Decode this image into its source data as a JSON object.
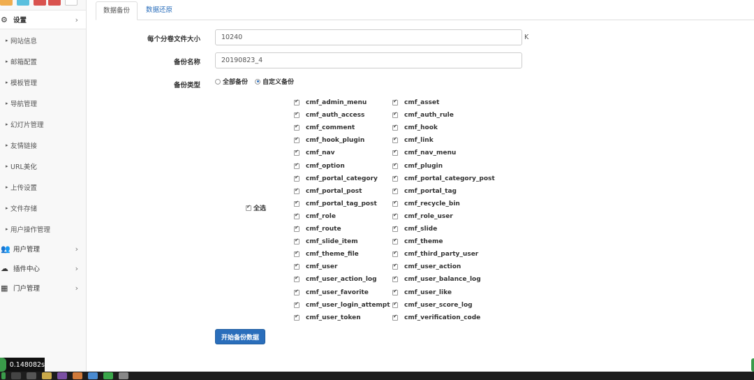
{
  "sidebar": {
    "top_buttons": [
      {
        "name": "top-button-1",
        "color": "#f0ad4e"
      },
      {
        "name": "top-button-2",
        "color": "#5bc0de"
      },
      {
        "name": "top-button-3",
        "color": "#d9534f"
      },
      {
        "name": "top-button-4",
        "color": "#d9534f"
      },
      {
        "name": "list-icon",
        "color": "#ffffff"
      }
    ],
    "settings": {
      "label": "设置",
      "icon": "gears-icon"
    },
    "items": [
      {
        "label": "网站信息"
      },
      {
        "label": "邮箱配置"
      },
      {
        "label": "模板管理"
      },
      {
        "label": "导航管理"
      },
      {
        "label": "幻灯片管理"
      },
      {
        "label": "友情链接"
      },
      {
        "label": "URL美化"
      },
      {
        "label": "上传设置"
      },
      {
        "label": "文件存储"
      },
      {
        "label": "用户操作管理"
      }
    ],
    "groups": [
      {
        "label": "用户管理",
        "icon": "users-icon"
      },
      {
        "label": "插件中心",
        "icon": "cloud-icon"
      },
      {
        "label": "门户管理",
        "icon": "grid-icon"
      }
    ]
  },
  "tabs": [
    {
      "label": "数据备份",
      "active": true
    },
    {
      "label": "数据还原",
      "active": false
    }
  ],
  "form": {
    "volume_size_label": "每个分卷文件大小",
    "volume_size_value": "10240",
    "volume_size_unit": "K",
    "backup_name_label": "备份名称",
    "backup_name_value": "20190823_4",
    "backup_type_label": "备份类型",
    "backup_type_options": [
      "全部备份",
      "自定义备份"
    ],
    "backup_type_selected": "自定义备份",
    "select_all_label": "全选",
    "tables": [
      "cmf_admin_menu",
      "cmf_asset",
      "cmf_auth_access",
      "cmf_auth_rule",
      "cmf_comment",
      "cmf_hook",
      "cmf_hook_plugin",
      "cmf_link",
      "cmf_nav",
      "cmf_nav_menu",
      "cmf_option",
      "cmf_plugin",
      "cmf_portal_category",
      "cmf_portal_category_post",
      "cmf_portal_post",
      "cmf_portal_tag",
      "cmf_portal_tag_post",
      "cmf_recycle_bin",
      "cmf_role",
      "cmf_role_user",
      "cmf_route",
      "cmf_slide",
      "cmf_slide_item",
      "cmf_theme",
      "cmf_theme_file",
      "cmf_third_party_user",
      "cmf_user",
      "cmf_user_action",
      "cmf_user_action_log",
      "cmf_user_balance_log",
      "cmf_user_favorite",
      "cmf_user_like",
      "cmf_user_login_attempt",
      "cmf_user_score_log",
      "cmf_user_token",
      "cmf_verification_code"
    ],
    "submit_label": "开始备份数据"
  },
  "timer": {
    "value": "0.148082s"
  },
  "colors": {
    "primary": "#2a6ebb",
    "link": "#2a6ebb",
    "taskbar": "#1d1d1d"
  }
}
